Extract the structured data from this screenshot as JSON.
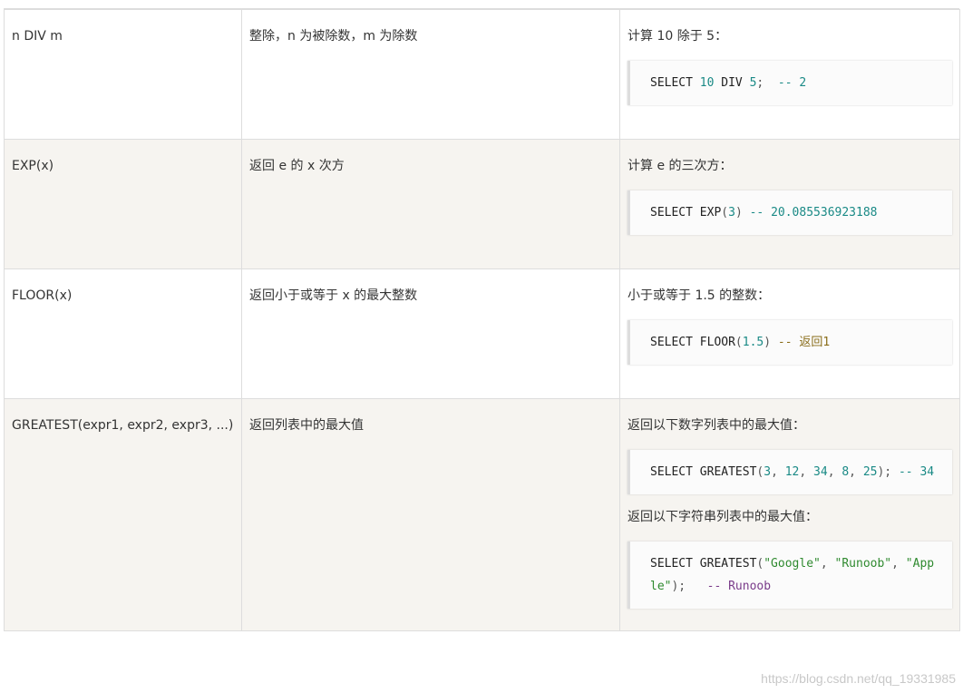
{
  "rows": [
    {
      "function": "n DIV m",
      "description": "整除，n 为被除数，m 为除数",
      "examples": [
        {
          "label": "计算 10 除于 5：",
          "code": {
            "kw": "SELECT",
            "num1": "10",
            "mid": "DIV",
            "num2": "5",
            "semi": ";",
            "comment_dash": "--",
            "comment_val": "2"
          }
        }
      ]
    },
    {
      "function": "EXP(x)",
      "description": "返回 e 的 x 次方",
      "examples": [
        {
          "label": "计算 e 的三次方：",
          "code": {
            "kw": "SELECT EXP",
            "open": "(",
            "arg": "3",
            "close": ")",
            "comment_dash": "--",
            "comment_val": "20.085536923188"
          }
        }
      ]
    },
    {
      "function": "FLOOR(x)",
      "description": "返回小于或等于 x 的最大整数",
      "examples": [
        {
          "label": "小于或等于 1.5 的整数：",
          "code": {
            "kw": "SELECT FLOOR",
            "open": "(",
            "arg": "1.5",
            "close": ")",
            "comment_dash": "--",
            "comment_val": "返回1"
          }
        }
      ]
    },
    {
      "function": "GREATEST(expr1, expr2, expr3, ...)",
      "description": "返回列表中的最大值",
      "examples": [
        {
          "label": "返回以下数字列表中的最大值：",
          "code": {
            "kw": "SELECT GREATEST",
            "open": "(",
            "a1": "3",
            "a2": "12",
            "a3": "34",
            "a4": "8",
            "a5": "25",
            "close": ");",
            "comment_dash": "--",
            "comment_val": "34"
          }
        },
        {
          "label": "返回以下字符串列表中的最大值：",
          "code": {
            "kw": "SELECT GREATEST",
            "open": "(",
            "s1": "\"Google\"",
            "s2": "\"Runoob\"",
            "s3": "\"Apple\"",
            "close": ");",
            "comment_dash": "--",
            "comment_val": "Runoob"
          }
        }
      ]
    }
  ],
  "watermark": "https://blog.csdn.net/qq_19331985"
}
